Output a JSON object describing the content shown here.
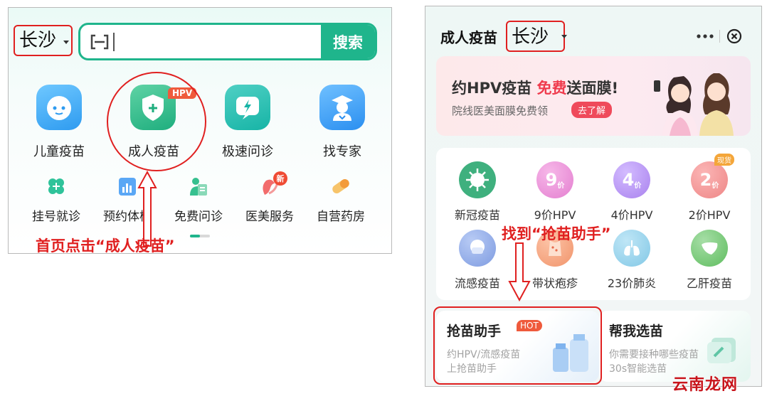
{
  "left": {
    "city": "长沙",
    "search_button": "搜索",
    "main_services": [
      {
        "label": "儿童疫苗",
        "icon": "baby-face-icon"
      },
      {
        "label": "成人疫苗",
        "icon": "shield-plus-icon",
        "tag": "HPV"
      },
      {
        "label": "极速问诊",
        "icon": "lightning-chat-icon"
      },
      {
        "label": "找专家",
        "icon": "doctor-icon"
      }
    ],
    "sub_services": [
      {
        "label": "挂号就诊",
        "icon": "clover-icon"
      },
      {
        "label": "预约体检",
        "icon": "clipboard-chart-icon"
      },
      {
        "label": "免费问诊",
        "icon": "person-doc-icon"
      },
      {
        "label": "医美服务",
        "icon": "face-beauty-icon",
        "badge": "新"
      },
      {
        "label": "自营药房",
        "icon": "pill-icon"
      }
    ],
    "annotation": "首页点击“成人疫苗”"
  },
  "right": {
    "title": "成人疫苗",
    "city": "长沙",
    "banner": {
      "title_pre": "约HPV疫苗 ",
      "title_hl": "免费",
      "title_post": "送面膜!",
      "subtitle": "院线医美面膜免费领",
      "cta": "去了解"
    },
    "vaccines": [
      {
        "label": "新冠疫苗",
        "icon": "virus-icon",
        "color": "#36b37e"
      },
      {
        "label": "9价HPV",
        "icon_text": "9",
        "unit": "价",
        "color": "#ec8bd6"
      },
      {
        "label": "4价HPV",
        "icon_text": "4",
        "unit": "价",
        "color": "#b28cf0"
      },
      {
        "label": "2价HPV",
        "icon_text": "2",
        "unit": "价",
        "color": "#f29494",
        "tag": "现货"
      },
      {
        "label": "流感疫苗",
        "icon": "mask-face-icon",
        "color": "#8fa9e6"
      },
      {
        "label": "带状疱疹",
        "icon": "body-icon",
        "color": "#f5a37e"
      },
      {
        "label": "23价肺炎",
        "icon": "lungs-icon",
        "color": "#8dcfea"
      },
      {
        "label": "乙肝疫苗",
        "icon": "liver-icon",
        "color": "#6cc36c"
      }
    ],
    "annotation": "找到“抢苗助手”",
    "helper": {
      "title": "抢苗助手",
      "tag": "HOT",
      "line1": "约HPV/流感疫苗",
      "line2": "上抢苗助手"
    },
    "picker": {
      "title": "帮我选苗",
      "line1": "你需要接种哪些疫苗",
      "line2": "30s智能选苗"
    }
  },
  "watermark": "云南龙网"
}
